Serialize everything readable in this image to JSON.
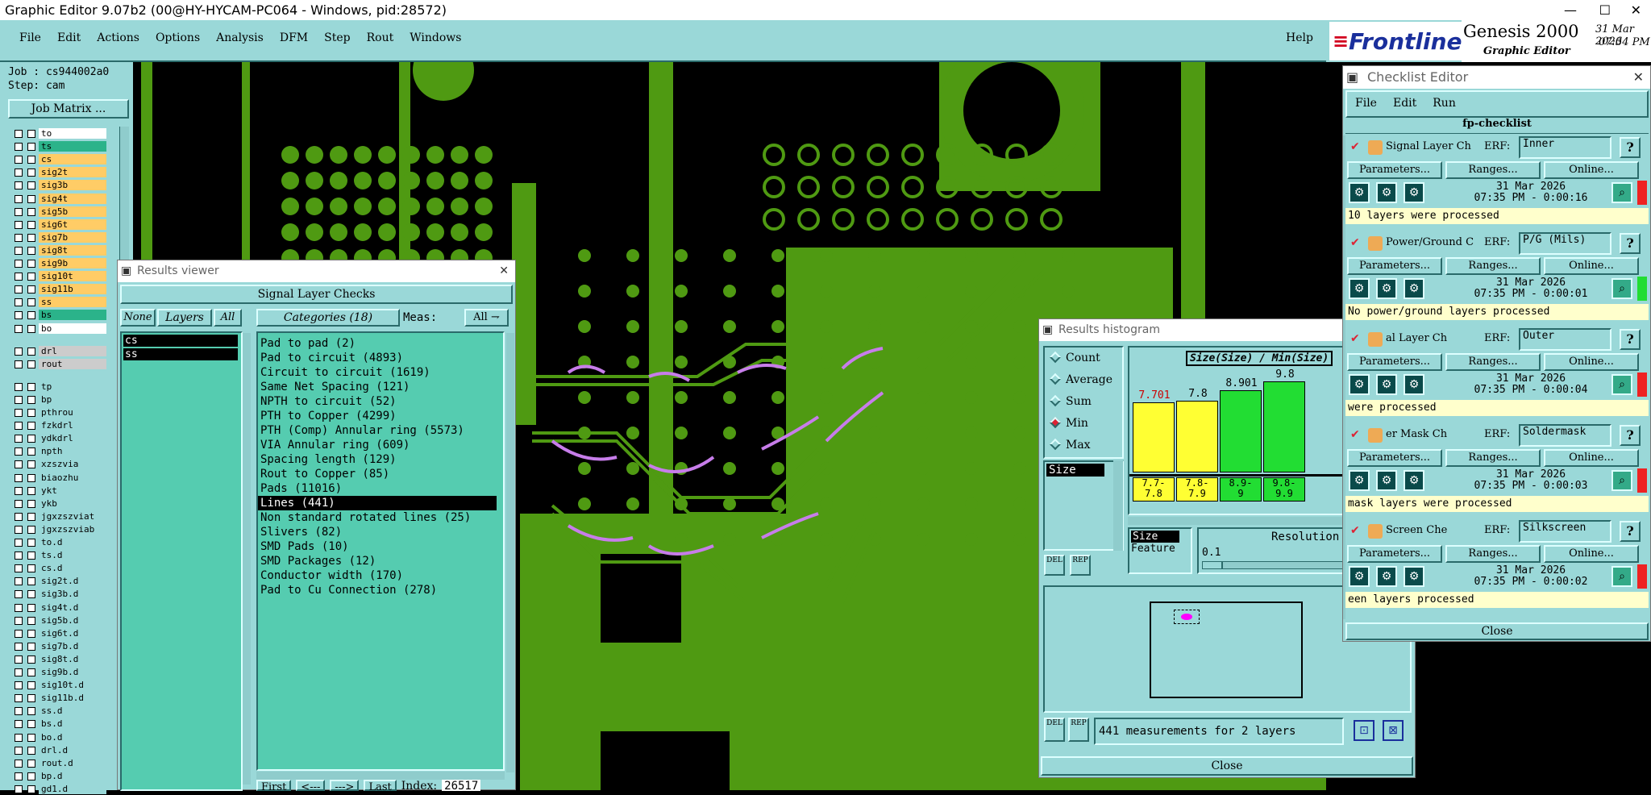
{
  "app": {
    "title": "Graphic Editor 9.07b2 (00@HY-HYCAM-PC064 - Windows, pid:28572)"
  },
  "menu": {
    "items": [
      "File",
      "Edit",
      "Actions",
      "Options",
      "Analysis",
      "DFM",
      "Step",
      "Rout",
      "Windows"
    ],
    "help": "Help"
  },
  "brand": {
    "logo": "Frontline",
    "product": "Genesis 2000",
    "subtitle": "Graphic Editor",
    "date": "31 Mar 2026",
    "time": "07:34 PM"
  },
  "job": {
    "job": "Job : cs944002a0",
    "step": "Step: cam",
    "matrix_button": "Job Matrix ..."
  },
  "layers": [
    {
      "name": "to",
      "color": "#ffffff"
    },
    {
      "name": "ts",
      "color": "#2bb38a"
    },
    {
      "name": "cs",
      "color": "#ffcc66"
    },
    {
      "name": "sig2t",
      "color": "#ffcc66"
    },
    {
      "name": "sig3b",
      "color": "#ffcc66"
    },
    {
      "name": "sig4t",
      "color": "#ffcc66"
    },
    {
      "name": "sig5b",
      "color": "#ffcc66"
    },
    {
      "name": "sig6t",
      "color": "#ffcc66"
    },
    {
      "name": "sig7b",
      "color": "#ffcc66"
    },
    {
      "name": "sig8t",
      "color": "#ffcc66"
    },
    {
      "name": "sig9b",
      "color": "#ffcc66"
    },
    {
      "name": "sig10t",
      "color": "#ffcc66"
    },
    {
      "name": "sig11b",
      "color": "#ffcc66"
    },
    {
      "name": "ss",
      "color": "#ffcc66"
    },
    {
      "name": "bs",
      "color": "#2bb38a"
    },
    {
      "name": "bo",
      "color": "#ffffff"
    },
    {
      "name": "drl",
      "color": "#cccccc"
    },
    {
      "name": "rout",
      "color": "#cccccc"
    },
    {
      "name": "tp",
      "color": "#9ad8d8"
    },
    {
      "name": "bp",
      "color": "#9ad8d8"
    },
    {
      "name": "pthrou",
      "color": "#9ad8d8"
    },
    {
      "name": "fzkdrl",
      "color": "#9ad8d8"
    },
    {
      "name": "ydkdrl",
      "color": "#9ad8d8"
    },
    {
      "name": "npth",
      "color": "#9ad8d8"
    },
    {
      "name": "xzszvia",
      "color": "#9ad8d8"
    },
    {
      "name": "biaozhu",
      "color": "#9ad8d8"
    },
    {
      "name": "ykt",
      "color": "#9ad8d8"
    },
    {
      "name": "ykb",
      "color": "#9ad8d8"
    },
    {
      "name": "jgxzszviat",
      "color": "#9ad8d8"
    },
    {
      "name": "jgxzszviab",
      "color": "#9ad8d8"
    },
    {
      "name": "to.d",
      "color": "#9ad8d8"
    },
    {
      "name": "ts.d",
      "color": "#9ad8d8"
    },
    {
      "name": "cs.d",
      "color": "#9ad8d8"
    },
    {
      "name": "sig2t.d",
      "color": "#9ad8d8"
    },
    {
      "name": "sig3b.d",
      "color": "#9ad8d8"
    },
    {
      "name": "sig4t.d",
      "color": "#9ad8d8"
    },
    {
      "name": "sig5b.d",
      "color": "#9ad8d8"
    },
    {
      "name": "sig6t.d",
      "color": "#9ad8d8"
    },
    {
      "name": "sig7b.d",
      "color": "#9ad8d8"
    },
    {
      "name": "sig8t.d",
      "color": "#9ad8d8"
    },
    {
      "name": "sig9b.d",
      "color": "#9ad8d8"
    },
    {
      "name": "sig10t.d",
      "color": "#9ad8d8"
    },
    {
      "name": "sig11b.d",
      "color": "#9ad8d8"
    },
    {
      "name": "ss.d",
      "color": "#9ad8d8"
    },
    {
      "name": "bs.d",
      "color": "#9ad8d8"
    },
    {
      "name": "bo.d",
      "color": "#9ad8d8"
    },
    {
      "name": "drl.d",
      "color": "#9ad8d8"
    },
    {
      "name": "rout.d",
      "color": "#9ad8d8"
    },
    {
      "name": "bp.d",
      "color": "#9ad8d8"
    },
    {
      "name": "gd1.d",
      "color": "#9ad8d8"
    }
  ],
  "results_viewer": {
    "title": "Results viewer",
    "section": "Signal Layer Checks",
    "none": "None",
    "layers_label": "Layers",
    "all": "All",
    "categories_label": "Categories (18)",
    "meas_label": "Meas:",
    "meas_value": "All",
    "selected_layers": [
      "cs",
      "ss"
    ],
    "categories": [
      "Pad to pad (2)",
      "Pad to circuit (4893)",
      "Circuit to circuit (1619)",
      "Same Net Spacing (121)",
      "NPTH to circuit (52)",
      "PTH to Copper (4299)",
      "PTH (Comp) Annular ring (5573)",
      "VIA Annular ring (609)",
      "Spacing length (129)",
      "Rout to Copper (85)",
      "Pads (11016)",
      "Lines (441)",
      "Non standard rotated lines (25)",
      "Slivers (82)",
      "SMD Pads (10)",
      "SMD Packages (12)",
      "Conductor width (170)",
      "Pad to Cu Connection (278)"
    ],
    "selected_category": "Lines (441)",
    "nav": {
      "first": "First",
      "prev": "<---",
      "next": "--->",
      "last": "Last",
      "index_label": "Index:",
      "index_value": "26517"
    }
  },
  "histogram": {
    "title": "Results histogram",
    "header": "Size(Size) / Min(Size)",
    "options": [
      "Count",
      "Average",
      "Sum",
      "Min",
      "Max"
    ],
    "selected_option": "Min",
    "size_tag": "Size",
    "size2": "Size",
    "feature": "Feature",
    "resolution_label": "Resolution",
    "resolution_value": "0.1",
    "status": "441 measurements for 2 layers",
    "close": "Close",
    "del": "DEL",
    "rep": "REP",
    "bars": [
      {
        "value": "7.701",
        "range": [
          "7.7-",
          "7.8"
        ],
        "color": "#ffff33",
        "label_color": "#cc0000",
        "level": 0.76
      },
      {
        "value": "7.8",
        "range": [
          "7.8-",
          "7.9"
        ],
        "color": "#ffff33",
        "label_color": "#000000",
        "level": 0.77
      },
      {
        "value": "8.901",
        "range": [
          "8.9-",
          "9"
        ],
        "color": "#22dd33",
        "label_color": "#000000",
        "level": 0.89
      },
      {
        "value": "9.8",
        "range": [
          "9.8-",
          "9.9"
        ],
        "color": "#22dd33",
        "label_color": "#000000",
        "level": 0.98
      }
    ]
  },
  "checklist": {
    "title": "Checklist Editor",
    "menu": [
      "File",
      "Edit",
      "Run"
    ],
    "name": "fp-checklist",
    "close": "Close",
    "params": "Parameters...",
    "ranges": "Ranges...",
    "online": "Online...",
    "erf_label": "ERF:",
    "help": "?",
    "items": [
      {
        "name": "Signal Layer Ch",
        "erf": "Inner",
        "date": "31 Mar 2026",
        "time": "07:35 PM - 0:00:16",
        "msg": "10 layers were processed",
        "status": "#ee2222"
      },
      {
        "name": "Power/Ground C",
        "erf": "P/G (Mils)",
        "date": "31 Mar 2026",
        "time": "07:35 PM - 0:00:01",
        "msg": "No power/ground layers processed",
        "status": "#22dd33"
      },
      {
        "name": "al Layer Ch",
        "erf": "Outer",
        "date": "31 Mar 2026",
        "time": "07:35 PM - 0:00:04",
        "msg": "were processed",
        "status": "#ee2222"
      },
      {
        "name": "er Mask Ch",
        "erf": "Soldermask",
        "date": "31 Mar 2026",
        "time": "07:35 PM - 0:00:03",
        "msg": "mask layers were processed",
        "status": "#ee2222"
      },
      {
        "name": "Screen Che",
        "erf": "Silkscreen",
        "date": "31 Mar 2026",
        "time": "07:35 PM - 0:00:02",
        "msg": "een layers processed",
        "status": "#ee2222"
      }
    ]
  }
}
